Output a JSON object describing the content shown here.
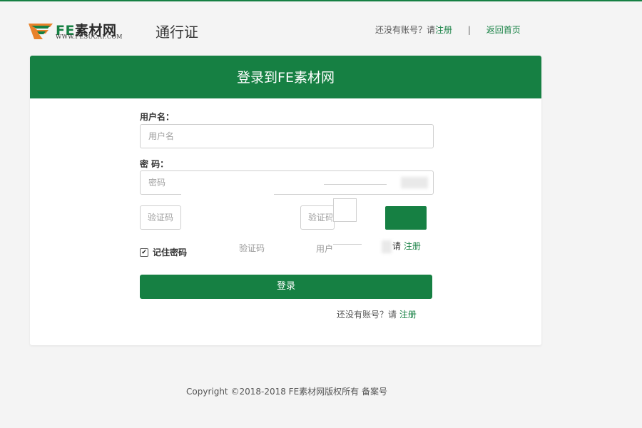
{
  "header": {
    "logo_fe": "FE",
    "logo_cn": "素材网",
    "logo_url": "WWW.FESUCAI.COM",
    "passport": "通行证",
    "no_account_text": "还没有账号？请",
    "register_link": "注册",
    "divider": "|",
    "back_home": "返回首页"
  },
  "card": {
    "title": "登录到FE素材网",
    "username_label": "用户名：",
    "username_placeholder": "用户名",
    "password_label": "密 码：",
    "password_placeholder": "密码",
    "captcha_placeholder": "验证码",
    "captcha_placeholder_2": "验证码",
    "ghost_captcha": "验证码",
    "ghost_user": "用户",
    "floating_register_prefix": "请",
    "floating_register_link": "注册",
    "remember_label": "记住密码",
    "remember_checked": true,
    "login_button": "登录",
    "no_account_text": "还没有账号？请",
    "register_link": "注册"
  },
  "footer": {
    "copyright": "Copyright ©2018-2018 FE素材网版权所有 备案号"
  },
  "colors": {
    "brand_green": "#168043",
    "page_bg": "#f4f4f4",
    "logo_orange": "#e8822a"
  }
}
